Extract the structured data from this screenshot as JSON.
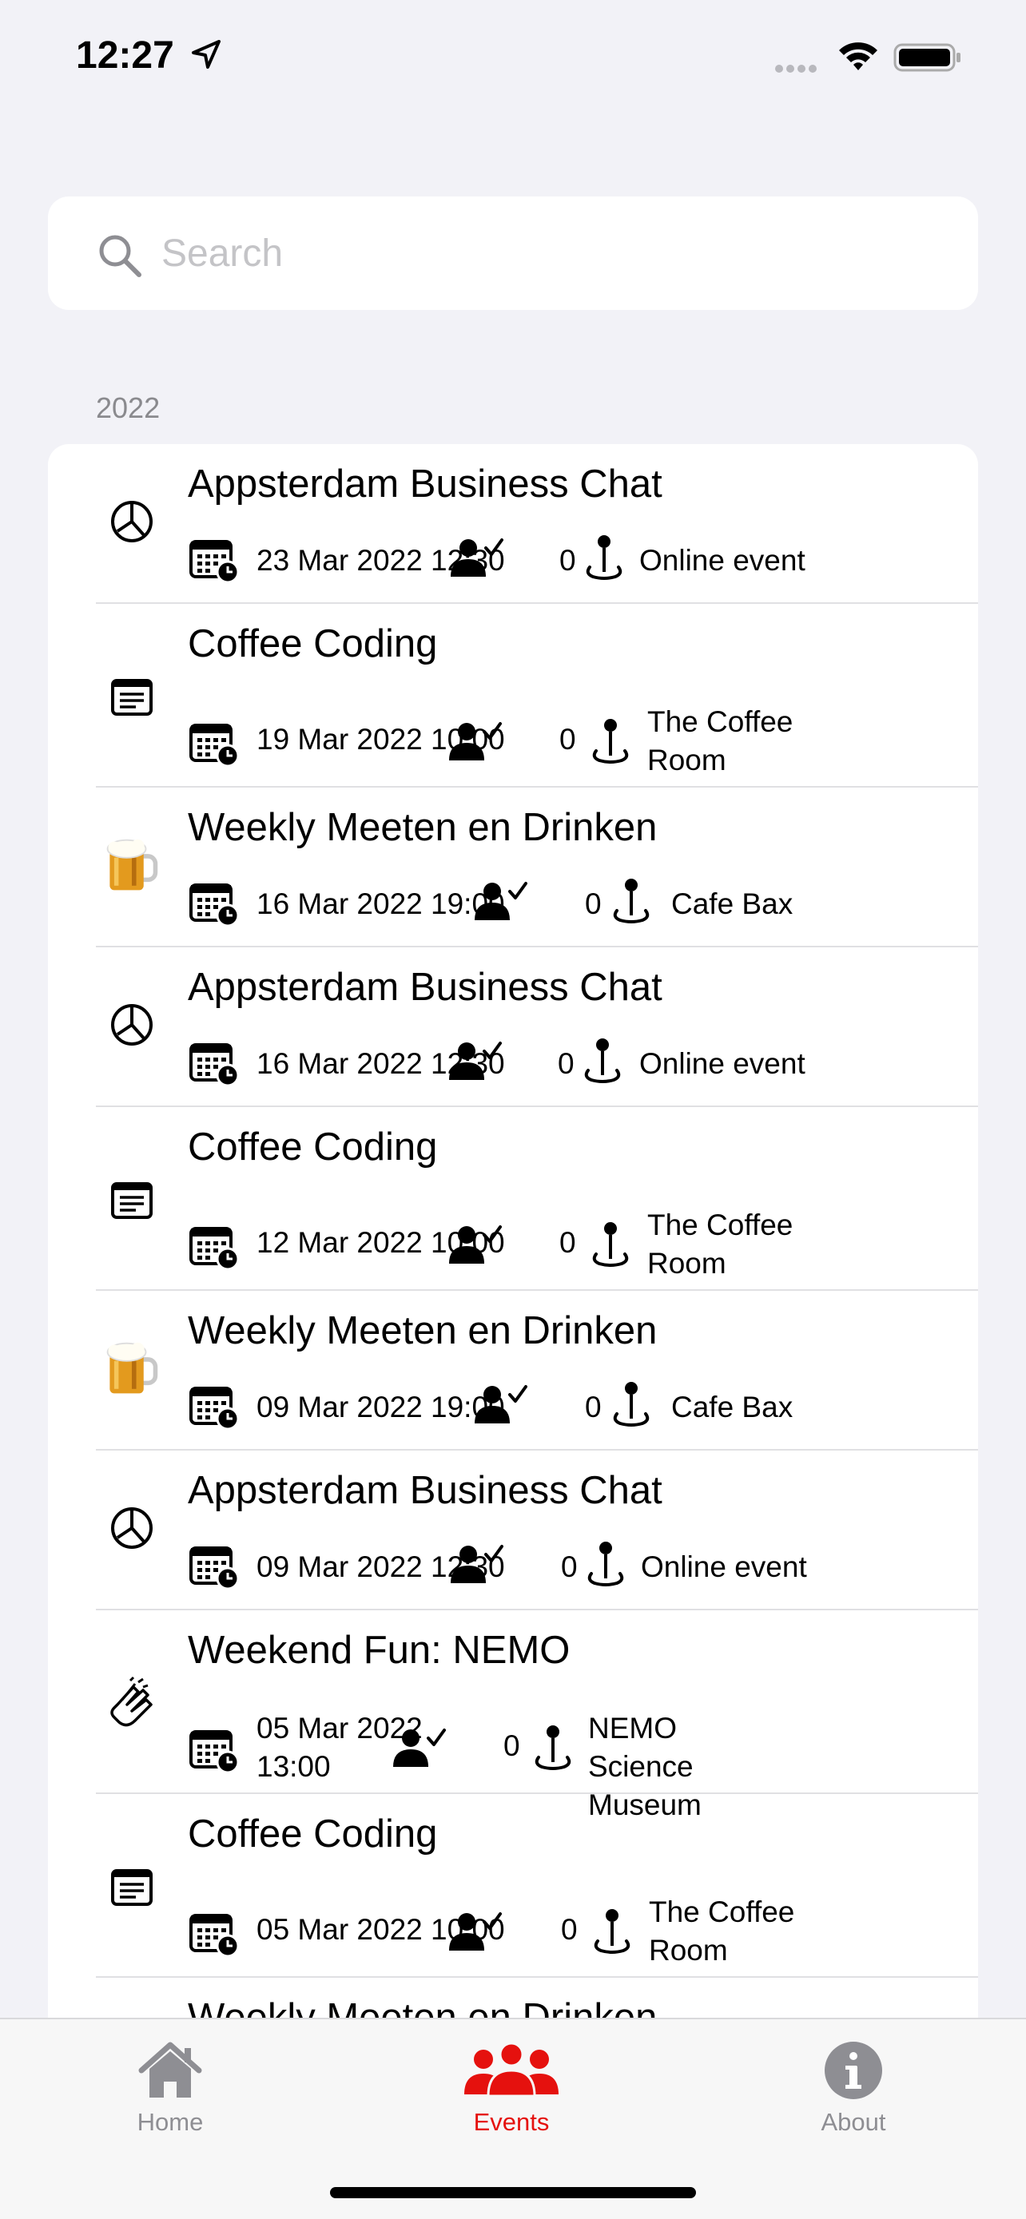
{
  "status_bar": {
    "time": "12:27"
  },
  "search": {
    "placeholder": "Search"
  },
  "section_header": "2022",
  "events": [
    {
      "icon": "pie-chart-icon",
      "title": "Appsterdam Business Chat",
      "date": "23 Mar 2022 12:30",
      "attendees": "0",
      "location": "Online event"
    },
    {
      "icon": "newspaper-icon",
      "title": "Coffee Coding",
      "date": "19 Mar 2022 10:00",
      "attendees": "0",
      "location": "The Coffee Room"
    },
    {
      "icon": "beer-icon",
      "title": "Weekly Meeten en Drinken",
      "date": "16 Mar 2022 19:00",
      "attendees": "0",
      "location": "Cafe Bax"
    },
    {
      "icon": "pie-chart-icon",
      "title": "Appsterdam Business Chat",
      "date": "16 Mar 2022 12:30",
      "attendees": "0",
      "location": "Online event"
    },
    {
      "icon": "newspaper-icon",
      "title": "Coffee Coding",
      "date": "12 Mar 2022 10:00",
      "attendees": "0",
      "location": "The Coffee Room"
    },
    {
      "icon": "beer-icon",
      "title": "Weekly Meeten en Drinken",
      "date": "09 Mar 2022 19:00",
      "attendees": "0",
      "location": "Cafe Bax"
    },
    {
      "icon": "pie-chart-icon",
      "title": "Appsterdam Business Chat",
      "date": "09 Mar 2022 12:30",
      "attendees": "0",
      "location": "Online event"
    },
    {
      "icon": "clapping-hands-icon",
      "title": "Weekend Fun: NEMO",
      "date": "05 Mar 2022 13:00",
      "attendees": "0",
      "location": "NEMO Science Museum"
    },
    {
      "icon": "newspaper-icon",
      "title": "Coffee Coding",
      "date": "05 Mar 2022 10:00",
      "attendees": "0",
      "location": "The Coffee Room"
    },
    {
      "icon": "beer-icon",
      "title": "Weekly Meeten en Drinken",
      "date": "",
      "attendees": "",
      "location": ""
    }
  ],
  "tabs": [
    {
      "label": "Home",
      "icon": "house-icon",
      "selected": false
    },
    {
      "label": "Events",
      "icon": "people-icon",
      "selected": true
    },
    {
      "label": "About",
      "icon": "info-icon",
      "selected": false
    }
  ],
  "colors": {
    "accent": "#e5110e",
    "inactive": "#8e8e93"
  }
}
